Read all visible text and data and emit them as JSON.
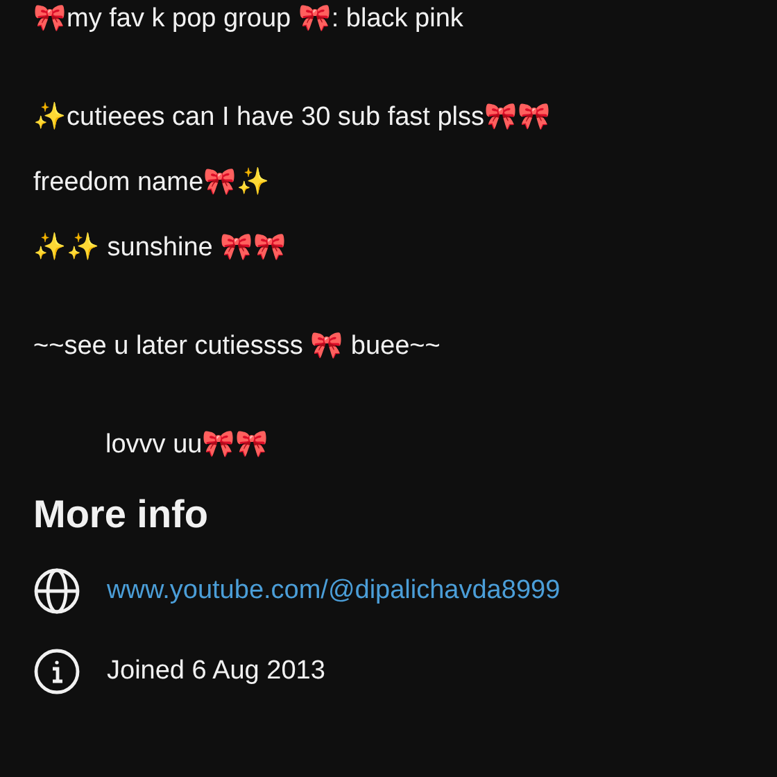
{
  "description": [
    {
      "text": "🎀my fav k pop group 🎀: black pink",
      "kind": "line"
    },
    {
      "text": "✨cutieees can I have 30 sub fast plss🎀🎀",
      "kind": "after_blank"
    },
    {
      "text": "freedom name🎀✨",
      "kind": "line"
    },
    {
      "text": "✨✨ sunshine 🎀🎀",
      "kind": "line"
    },
    {
      "text": "~~see u later cutiessss 🎀 buee~~",
      "kind": "after_blank"
    },
    {
      "text": "lovvv uu🎀🎀",
      "kind": "indented_after_blank"
    }
  ],
  "more_info": {
    "heading": "More info",
    "items": [
      {
        "kind": "link",
        "text": "www.youtube.com/@dipalichavda8999"
      },
      {
        "kind": "joined",
        "text": "Joined 6 Aug 2013"
      }
    ]
  }
}
